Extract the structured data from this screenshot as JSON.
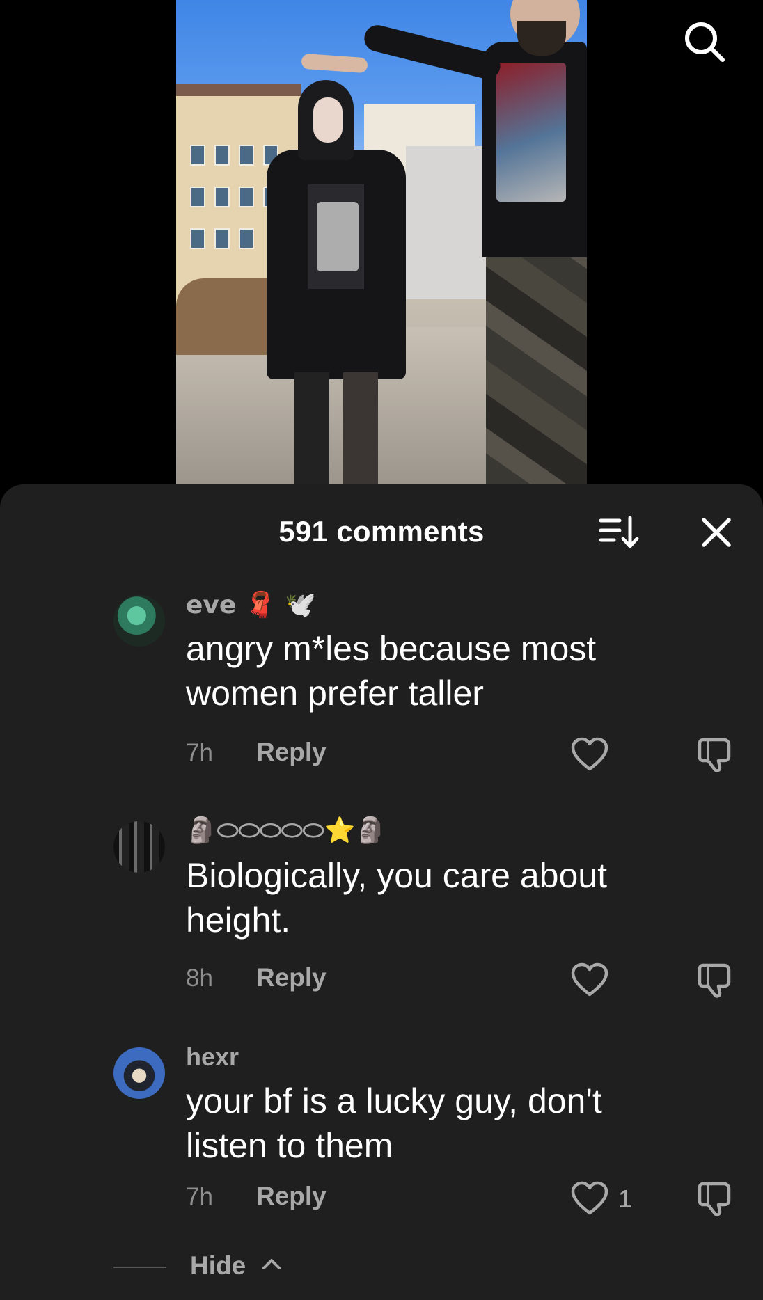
{
  "video": {
    "search_icon": "search-icon"
  },
  "comments_panel": {
    "title": "591 comments",
    "sort_icon": "sort-icon",
    "close_icon": "close-icon",
    "items": [
      {
        "username": "eve 🧣 🕊️",
        "text": "angry m*les because most women prefer taller",
        "time": "7h",
        "reply_label": "Reply",
        "like_count": ""
      },
      {
        "username": "🗿⬭⬭⬭⬭⬭⭐🗿",
        "text": "Biologically, you care about height.",
        "time": "8h",
        "reply_label": "Reply",
        "like_count": ""
      },
      {
        "username": "hexr",
        "text": "your bf is a lucky guy, don't listen to them",
        "time": "7h",
        "reply_label": "Reply",
        "like_count": "1"
      }
    ],
    "hide_label": "Hide"
  },
  "colors": {
    "sheet_bg": "#1f1f1f",
    "text_primary": "#ffffff",
    "text_secondary": "#a8a8a8"
  }
}
